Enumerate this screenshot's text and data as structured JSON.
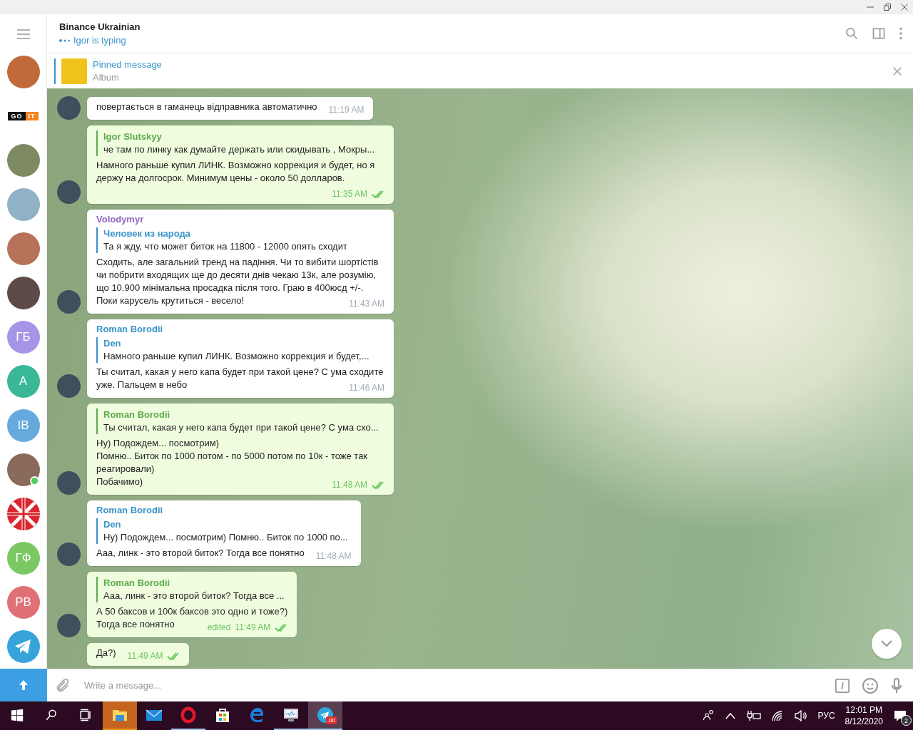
{
  "sidebar": {
    "avatars": [
      {
        "kind": "photo",
        "color": "#c06a3a"
      },
      {
        "kind": "logo",
        "parts": [
          "GO",
          "IT"
        ]
      },
      {
        "kind": "photo",
        "color": "#7d8a62"
      },
      {
        "kind": "photo",
        "color": "#8fb2c4"
      },
      {
        "kind": "photo",
        "color": "#b7735a"
      },
      {
        "kind": "photo",
        "color": "#5e4a48"
      },
      {
        "kind": "initials",
        "text": "ГБ",
        "color": "#a695e7"
      },
      {
        "kind": "initials",
        "text": "A",
        "color": "#3ab795"
      },
      {
        "kind": "initials",
        "text": "IB",
        "color": "#65aadd"
      },
      {
        "kind": "photo",
        "color": "#8a6a5a",
        "online": true
      },
      {
        "kind": "flag"
      },
      {
        "kind": "initials",
        "text": "ГФ",
        "color": "#7bc862"
      },
      {
        "kind": "initials",
        "text": "PB",
        "color": "#e17076"
      },
      {
        "kind": "telegram"
      }
    ]
  },
  "header": {
    "title": "Binance Ukrainian",
    "status": "Igor is typing"
  },
  "pinned": {
    "label": "Pinned message",
    "text": "Album"
  },
  "messages": [
    {
      "outgoing": false,
      "body": [
        "повертається в гаманець відправника автоматично"
      ],
      "time": "11:19 AM",
      "avatar": true
    },
    {
      "outgoing": true,
      "reply": {
        "author": "Igor Slutskyy",
        "text": "че там по линку как думайте держать или скидывать , Мокры..."
      },
      "body": [
        "Намного раньше купил ЛИНК. Возможно коррекция и будет, но я держу на долгосрок. Минимум цены - около 50 долларов."
      ],
      "time": "11:35 AM",
      "read": true,
      "avatar": true
    },
    {
      "outgoing": false,
      "author": "Volodymyr",
      "color": "#8e65c0",
      "reply": {
        "author": "Человек из народа",
        "text": "Та я жду, что может биток на 11800 - 12000 опять сходит"
      },
      "body": [
        "Сходить, але загальний тренд на падіння. Чи то вибити шортістів чи побрити входящих ще до десяти днів чекаю 13к, але розумію, що 10.900 мінімальна просадка після того. Граю в 400юсд +/-. Поки карусель крутиться - весело!"
      ],
      "time": "11:43 AM",
      "avatar": true
    },
    {
      "outgoing": false,
      "author": "Roman Borodii",
      "color": "#3a95c9",
      "reply": {
        "author": "Den",
        "text": "Намного раньше купил ЛИНК. Возможно коррекция и будет,..."
      },
      "body": [
        "Ты считал, какая у него капа будет при такой цене? С ума сходите уже. Пальцем в небо"
      ],
      "time": "11:46 AM",
      "avatar": true
    },
    {
      "outgoing": true,
      "reply": {
        "author": "Roman Borodii",
        "text": "Ты считал, какая у него капа будет при такой цене? С ума схо..."
      },
      "body": [
        "Ну) Подождем... посмотрим)",
        "Помню.. Биток по 1000 потом - по 5000 потом по 10к - тоже так реагировали)",
        "Побачимо)"
      ],
      "time": "11:48 AM",
      "read": true,
      "avatar": true
    },
    {
      "outgoing": false,
      "author": "Roman Borodii",
      "color": "#3a95c9",
      "reply": {
        "author": "Den",
        "text": "Ну) Подождем... посмотрим) Помню.. Биток по 1000 по..."
      },
      "body": [
        "Ааа, линк - это второй биток? Тогда все понятно"
      ],
      "time": "11:48 AM",
      "avatar": true
    },
    {
      "outgoing": true,
      "reply": {
        "author": "Roman Borodii",
        "text": "Ааа, линк - это второй биток? Тогда все ..."
      },
      "body": [
        "А 50 баксов и 100к баксов это одно и тоже?)",
        "Тогда все понятно"
      ],
      "edited": "edited",
      "time": "11:49 AM",
      "read": true,
      "avatar": true
    },
    {
      "outgoing": true,
      "body": [
        "Да?)"
      ],
      "time": "11:49 AM",
      "read": true,
      "avatar": false
    }
  ],
  "composer": {
    "placeholder": "Write a message..."
  },
  "taskbar": {
    "apps": [
      {
        "kind": "explorer",
        "selected": false,
        "running": true,
        "attention": true
      },
      {
        "kind": "mail",
        "selected": false,
        "running": false,
        "attention": false
      },
      {
        "kind": "opera",
        "selected": false,
        "running": true,
        "attention": false
      },
      {
        "kind": "store",
        "selected": false,
        "running": false,
        "attention": false
      },
      {
        "kind": "edge",
        "selected": false,
        "running": false,
        "attention": false
      },
      {
        "kind": "monitor",
        "selected": false,
        "running": true,
        "attention": false
      },
      {
        "kind": "telegram",
        "selected": true,
        "running": true,
        "attention": false,
        "badge": ".00"
      }
    ],
    "language": "РУС",
    "time": "12:01 PM",
    "date": "8/12/2020",
    "notifications": "2"
  }
}
